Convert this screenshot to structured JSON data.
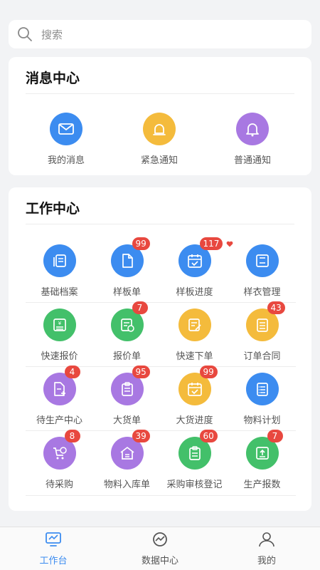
{
  "search": {
    "placeholder": "搜索"
  },
  "message_center": {
    "title": "消息中心",
    "items": [
      {
        "label": "我的消息",
        "icon": "mail-icon",
        "color": "#3c8cf0"
      },
      {
        "label": "紧急通知",
        "icon": "alarm-light-icon",
        "color": "#f4bb3c"
      },
      {
        "label": "普通通知",
        "icon": "bell-icon",
        "color": "#a878e2"
      }
    ]
  },
  "work_center": {
    "title": "工作中心",
    "items": [
      {
        "label": "基础档案",
        "badge": "",
        "icon": "archive-icon",
        "color": "#3c8cf0"
      },
      {
        "label": "样板单",
        "badge": "99",
        "icon": "document-icon",
        "color": "#3c8cf0"
      },
      {
        "label": "样板进度",
        "badge": "117",
        "icon": "calendar-icon",
        "color": "#3c8cf0"
      },
      {
        "label": "样衣管理",
        "badge": "",
        "icon": "save-icon",
        "color": "#3c8cf0"
      },
      {
        "label": "快速报价",
        "badge": "",
        "icon": "quote-icon",
        "color": "#43c06a"
      },
      {
        "label": "报价单",
        "badge": "7",
        "icon": "quote-list-icon",
        "color": "#43c06a"
      },
      {
        "label": "快速下单",
        "badge": "",
        "icon": "edit-order-icon",
        "color": "#f4bb3c"
      },
      {
        "label": "订单合同",
        "badge": "43",
        "icon": "contract-icon",
        "color": "#f4bb3c"
      },
      {
        "label": "待生产中心",
        "badge": "4",
        "icon": "production-icon",
        "color": "#a878e2"
      },
      {
        "label": "大货单",
        "badge": "95",
        "icon": "clipboard-icon",
        "color": "#a878e2"
      },
      {
        "label": "大货进度",
        "badge": "99",
        "icon": "calendar-check-icon",
        "color": "#f4bb3c"
      },
      {
        "label": "物料计划",
        "badge": "",
        "icon": "checklist-icon",
        "color": "#3c8cf0"
      },
      {
        "label": "待采购",
        "badge": "8",
        "icon": "cart-icon",
        "color": "#a878e2"
      },
      {
        "label": "物料入库单",
        "badge": "39",
        "icon": "warehouse-icon",
        "color": "#a878e2"
      },
      {
        "label": "采购审核登记",
        "badge": "60",
        "icon": "audit-icon",
        "color": "#43c06a"
      },
      {
        "label": "生产报数",
        "badge": "7",
        "icon": "upload-report-icon",
        "color": "#43c06a"
      }
    ]
  },
  "tabbar": {
    "items": [
      {
        "label": "工作台",
        "icon": "workbench-icon",
        "active": true
      },
      {
        "label": "数据中心",
        "icon": "chart-icon",
        "active": false
      },
      {
        "label": "我的",
        "icon": "user-icon",
        "active": false
      }
    ]
  }
}
